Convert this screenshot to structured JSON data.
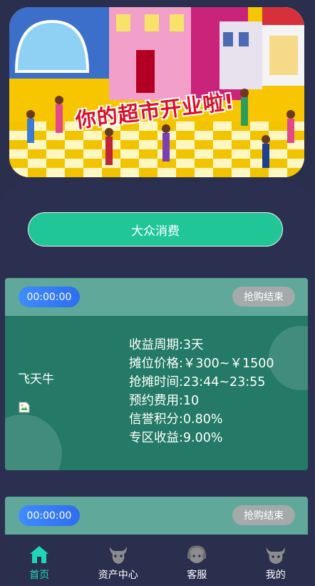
{
  "banner": {
    "headline": "你的超市开业啦!"
  },
  "main_button": {
    "label": "大众消费"
  },
  "cards": [
    {
      "timer": "00:00:00",
      "status": "抢购结束",
      "product_name": "飞天牛",
      "stats": [
        {
          "label": "收益周期:",
          "value": "3天"
        },
        {
          "label": "摊位价格:",
          "value": "￥300~￥1500"
        },
        {
          "label": "抢摊时间:",
          "value": "23:44~23:55"
        },
        {
          "label": "预约费用:",
          "value": "10"
        },
        {
          "label": "信誉积分:",
          "value": "0.80%"
        },
        {
          "label": "专区收益:",
          "value": "9.00%"
        }
      ]
    },
    {
      "timer": "00:00:00",
      "status": "抢购结束"
    }
  ],
  "nav": {
    "items": [
      {
        "label": "首页",
        "icon": "home-icon",
        "active": true
      },
      {
        "label": "资产中心",
        "icon": "bull-icon",
        "active": false
      },
      {
        "label": "客服",
        "icon": "headset-icon",
        "active": false
      },
      {
        "label": "我的",
        "icon": "bull-profile-icon",
        "active": false
      }
    ],
    "active_color": "#20d4b8",
    "inactive_icon_color": "#8c8c8c"
  }
}
